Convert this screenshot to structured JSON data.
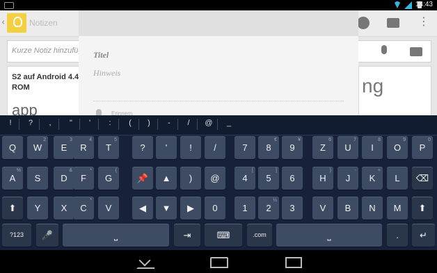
{
  "status_bar": {
    "time": "14:43"
  },
  "action_bar": {
    "title": "Notizen"
  },
  "compose": {
    "placeholder": "Kurze Notiz hinzufügen"
  },
  "cards": [
    {
      "title": "S2 auf Android 4.4 ROM",
      "preview": "app"
    },
    {
      "preview": "ng"
    }
  ],
  "dialog": {
    "title_placeholder": "Titel",
    "note_placeholder": "Hinweis",
    "reminder_label": "Erinnern"
  },
  "keyboard": {
    "symbols": [
      "!",
      "?",
      ",",
      "\"",
      "'",
      ":",
      "(",
      ")",
      "-",
      "/",
      "@",
      "_"
    ],
    "row1": [
      {
        "k": "Q",
        "h": ""
      },
      {
        "k": "W",
        "h": "2"
      },
      {
        "k": "E",
        "h": "3"
      },
      {
        "k": "R",
        "h": "4"
      },
      {
        "k": "T",
        "h": "5"
      },
      {
        "k": "?",
        "h": ""
      },
      {
        "k": "'",
        "h": ""
      },
      {
        "k": "!",
        "h": ""
      },
      {
        "k": "/",
        "h": ""
      },
      {
        "k": "7",
        "h": ""
      },
      {
        "k": "8",
        "h": "€"
      },
      {
        "k": "9",
        "h": "¥"
      },
      {
        "k": "Z",
        "h": "6"
      },
      {
        "k": "U",
        "h": "7"
      },
      {
        "k": "I",
        "h": "8"
      },
      {
        "k": "O",
        "h": "9"
      },
      {
        "k": "P",
        "h": "0"
      }
    ],
    "row2": [
      {
        "k": "A",
        "h": "%"
      },
      {
        "k": "S",
        "h": ""
      },
      {
        "k": "D",
        "h": "&"
      },
      {
        "k": "F",
        "h": "*"
      },
      {
        "k": "G",
        "h": "("
      },
      {
        "k": "pin",
        "h": ""
      },
      {
        "k": "▲",
        "h": ""
      },
      {
        "k": ")",
        "h": ""
      },
      {
        "k": "@",
        "h": ""
      },
      {
        "k": "4",
        "h": "["
      },
      {
        "k": "5",
        "h": "]"
      },
      {
        "k": "6",
        "h": ""
      },
      {
        "k": "H",
        "h": ")"
      },
      {
        "k": "J",
        "h": "-"
      },
      {
        "k": "K",
        "h": "+"
      },
      {
        "k": "L",
        "h": ""
      },
      {
        "k": "del",
        "h": ""
      }
    ],
    "row3": [
      {
        "k": "shift",
        "h": ""
      },
      {
        "k": "Y",
        "h": ""
      },
      {
        "k": "X",
        "h": ""
      },
      {
        "k": "C",
        "h": "*"
      },
      {
        "k": "V",
        "h": ""
      },
      {
        "k": "◀",
        "h": ""
      },
      {
        "k": "▼",
        "h": ""
      },
      {
        "k": "▶",
        "h": ""
      },
      {
        "k": "0",
        "h": ""
      },
      {
        "k": "1",
        "h": ""
      },
      {
        "k": "2",
        "h": "½"
      },
      {
        "k": "3",
        "h": ""
      },
      {
        "k": "V",
        "h": ""
      },
      {
        "k": "B",
        "h": ""
      },
      {
        "k": "N",
        "h": ""
      },
      {
        "k": "M",
        "h": ""
      },
      {
        "k": "shift",
        "h": ""
      }
    ],
    "row4": {
      "numbers": "?123",
      "dotcom": ".com",
      "dot": "."
    }
  },
  "colors": {
    "keyboard_bg": "#17223a",
    "key": "#3d4b63",
    "accent": "#33b5e5"
  }
}
